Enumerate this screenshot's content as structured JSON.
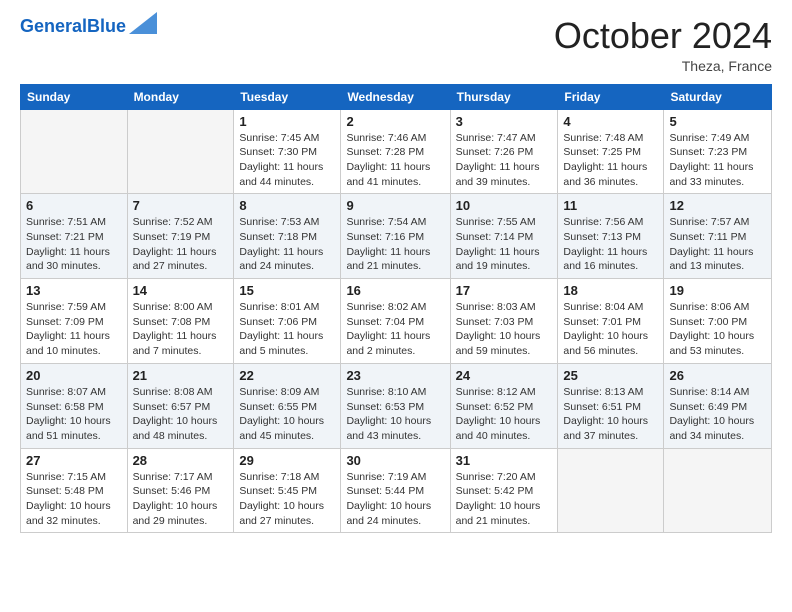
{
  "header": {
    "logo_line1": "General",
    "logo_line2": "Blue",
    "month": "October 2024",
    "location": "Theza, France"
  },
  "days_of_week": [
    "Sunday",
    "Monday",
    "Tuesday",
    "Wednesday",
    "Thursday",
    "Friday",
    "Saturday"
  ],
  "weeks": [
    [
      {
        "day": "",
        "empty": true
      },
      {
        "day": "",
        "empty": true
      },
      {
        "day": "1",
        "sunrise": "Sunrise: 7:45 AM",
        "sunset": "Sunset: 7:30 PM",
        "daylight": "Daylight: 11 hours and 44 minutes."
      },
      {
        "day": "2",
        "sunrise": "Sunrise: 7:46 AM",
        "sunset": "Sunset: 7:28 PM",
        "daylight": "Daylight: 11 hours and 41 minutes."
      },
      {
        "day": "3",
        "sunrise": "Sunrise: 7:47 AM",
        "sunset": "Sunset: 7:26 PM",
        "daylight": "Daylight: 11 hours and 39 minutes."
      },
      {
        "day": "4",
        "sunrise": "Sunrise: 7:48 AM",
        "sunset": "Sunset: 7:25 PM",
        "daylight": "Daylight: 11 hours and 36 minutes."
      },
      {
        "day": "5",
        "sunrise": "Sunrise: 7:49 AM",
        "sunset": "Sunset: 7:23 PM",
        "daylight": "Daylight: 11 hours and 33 minutes."
      }
    ],
    [
      {
        "day": "6",
        "sunrise": "Sunrise: 7:51 AM",
        "sunset": "Sunset: 7:21 PM",
        "daylight": "Daylight: 11 hours and 30 minutes."
      },
      {
        "day": "7",
        "sunrise": "Sunrise: 7:52 AM",
        "sunset": "Sunset: 7:19 PM",
        "daylight": "Daylight: 11 hours and 27 minutes."
      },
      {
        "day": "8",
        "sunrise": "Sunrise: 7:53 AM",
        "sunset": "Sunset: 7:18 PM",
        "daylight": "Daylight: 11 hours and 24 minutes."
      },
      {
        "day": "9",
        "sunrise": "Sunrise: 7:54 AM",
        "sunset": "Sunset: 7:16 PM",
        "daylight": "Daylight: 11 hours and 21 minutes."
      },
      {
        "day": "10",
        "sunrise": "Sunrise: 7:55 AM",
        "sunset": "Sunset: 7:14 PM",
        "daylight": "Daylight: 11 hours and 19 minutes."
      },
      {
        "day": "11",
        "sunrise": "Sunrise: 7:56 AM",
        "sunset": "Sunset: 7:13 PM",
        "daylight": "Daylight: 11 hours and 16 minutes."
      },
      {
        "day": "12",
        "sunrise": "Sunrise: 7:57 AM",
        "sunset": "Sunset: 7:11 PM",
        "daylight": "Daylight: 11 hours and 13 minutes."
      }
    ],
    [
      {
        "day": "13",
        "sunrise": "Sunrise: 7:59 AM",
        "sunset": "Sunset: 7:09 PM",
        "daylight": "Daylight: 11 hours and 10 minutes."
      },
      {
        "day": "14",
        "sunrise": "Sunrise: 8:00 AM",
        "sunset": "Sunset: 7:08 PM",
        "daylight": "Daylight: 11 hours and 7 minutes."
      },
      {
        "day": "15",
        "sunrise": "Sunrise: 8:01 AM",
        "sunset": "Sunset: 7:06 PM",
        "daylight": "Daylight: 11 hours and 5 minutes."
      },
      {
        "day": "16",
        "sunrise": "Sunrise: 8:02 AM",
        "sunset": "Sunset: 7:04 PM",
        "daylight": "Daylight: 11 hours and 2 minutes."
      },
      {
        "day": "17",
        "sunrise": "Sunrise: 8:03 AM",
        "sunset": "Sunset: 7:03 PM",
        "daylight": "Daylight: 10 hours and 59 minutes."
      },
      {
        "day": "18",
        "sunrise": "Sunrise: 8:04 AM",
        "sunset": "Sunset: 7:01 PM",
        "daylight": "Daylight: 10 hours and 56 minutes."
      },
      {
        "day": "19",
        "sunrise": "Sunrise: 8:06 AM",
        "sunset": "Sunset: 7:00 PM",
        "daylight": "Daylight: 10 hours and 53 minutes."
      }
    ],
    [
      {
        "day": "20",
        "sunrise": "Sunrise: 8:07 AM",
        "sunset": "Sunset: 6:58 PM",
        "daylight": "Daylight: 10 hours and 51 minutes."
      },
      {
        "day": "21",
        "sunrise": "Sunrise: 8:08 AM",
        "sunset": "Sunset: 6:57 PM",
        "daylight": "Daylight: 10 hours and 48 minutes."
      },
      {
        "day": "22",
        "sunrise": "Sunrise: 8:09 AM",
        "sunset": "Sunset: 6:55 PM",
        "daylight": "Daylight: 10 hours and 45 minutes."
      },
      {
        "day": "23",
        "sunrise": "Sunrise: 8:10 AM",
        "sunset": "Sunset: 6:53 PM",
        "daylight": "Daylight: 10 hours and 43 minutes."
      },
      {
        "day": "24",
        "sunrise": "Sunrise: 8:12 AM",
        "sunset": "Sunset: 6:52 PM",
        "daylight": "Daylight: 10 hours and 40 minutes."
      },
      {
        "day": "25",
        "sunrise": "Sunrise: 8:13 AM",
        "sunset": "Sunset: 6:51 PM",
        "daylight": "Daylight: 10 hours and 37 minutes."
      },
      {
        "day": "26",
        "sunrise": "Sunrise: 8:14 AM",
        "sunset": "Sunset: 6:49 PM",
        "daylight": "Daylight: 10 hours and 34 minutes."
      }
    ],
    [
      {
        "day": "27",
        "sunrise": "Sunrise: 7:15 AM",
        "sunset": "Sunset: 5:48 PM",
        "daylight": "Daylight: 10 hours and 32 minutes."
      },
      {
        "day": "28",
        "sunrise": "Sunrise: 7:17 AM",
        "sunset": "Sunset: 5:46 PM",
        "daylight": "Daylight: 10 hours and 29 minutes."
      },
      {
        "day": "29",
        "sunrise": "Sunrise: 7:18 AM",
        "sunset": "Sunset: 5:45 PM",
        "daylight": "Daylight: 10 hours and 27 minutes."
      },
      {
        "day": "30",
        "sunrise": "Sunrise: 7:19 AM",
        "sunset": "Sunset: 5:44 PM",
        "daylight": "Daylight: 10 hours and 24 minutes."
      },
      {
        "day": "31",
        "sunrise": "Sunrise: 7:20 AM",
        "sunset": "Sunset: 5:42 PM",
        "daylight": "Daylight: 10 hours and 21 minutes."
      },
      {
        "day": "",
        "empty": true
      },
      {
        "day": "",
        "empty": true
      }
    ]
  ]
}
